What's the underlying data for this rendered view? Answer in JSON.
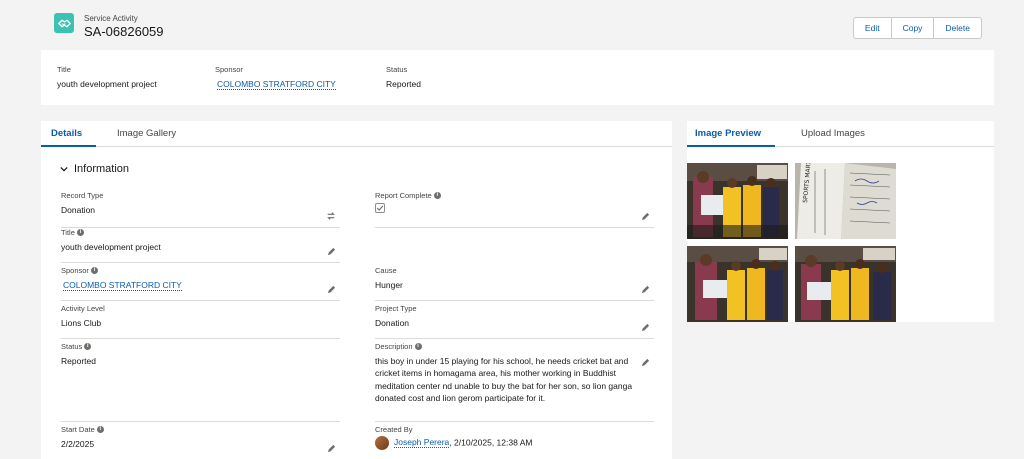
{
  "header": {
    "object_label": "Service Activity",
    "record_name": "SA-06826059",
    "icon": "handshake-icon",
    "icon_color": "#3cc2b3",
    "actions": [
      "Edit",
      "Copy",
      "Delete"
    ]
  },
  "highlights": [
    {
      "label": "Title",
      "value": "youth development project",
      "link": false
    },
    {
      "label": "Sponsor",
      "value": "COLOMBO STRATFORD CITY",
      "link": true
    },
    {
      "label": "Status",
      "value": "Reported",
      "link": false
    }
  ],
  "tabs": {
    "left": [
      "Details",
      "Image Gallery"
    ],
    "right": [
      "Image Preview",
      "Upload Images"
    ]
  },
  "section": {
    "title": "Information"
  },
  "fields": {
    "record_type": {
      "label": "Record Type",
      "value": "Donation"
    },
    "report_complete": {
      "label": "Report Complete",
      "checked": true
    },
    "title": {
      "label": "Title",
      "value": "youth development project"
    },
    "sponsor": {
      "label": "Sponsor",
      "value": "COLOMBO STRATFORD CITY"
    },
    "cause": {
      "label": "Cause",
      "value": "Hunger"
    },
    "activity_level": {
      "label": "Activity Level",
      "value": "Lions Club"
    },
    "project_type": {
      "label": "Project Type",
      "value": "Donation"
    },
    "status": {
      "label": "Status",
      "value": "Reported"
    },
    "description": {
      "label": "Description",
      "value": "this boy in under 15 playing for his school, he needs cricket bat and cricket items in homagama area, his mother working in Buddhist meditation center nd unable to buy the bat for her son, so lion ganga donated cost and lion gerom participate for it."
    },
    "start_date": {
      "label": "Start Date",
      "value": "2/2/2025"
    },
    "created_by": {
      "label": "Created By",
      "user": "Joseph Perera",
      "datetime": ", 2/10/2025, 12:38 AM"
    }
  },
  "colors": {
    "accent": "#0b5cab",
    "brand": "#3cc2b3"
  }
}
